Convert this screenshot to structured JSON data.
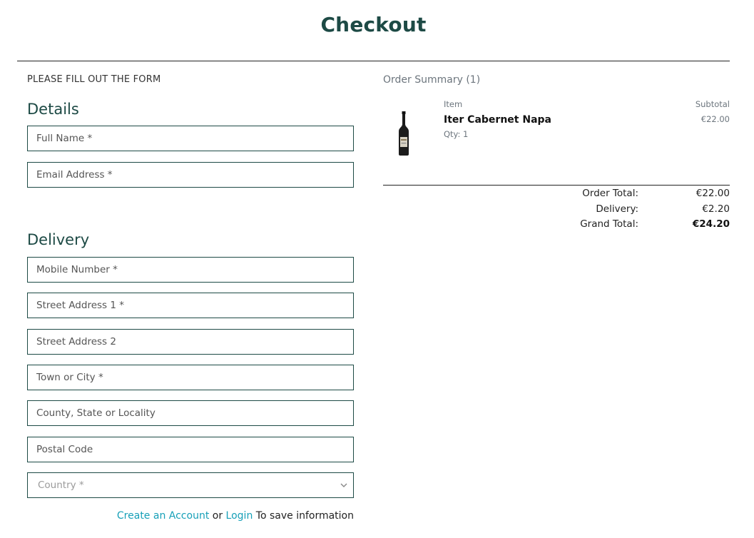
{
  "page": {
    "title": "Checkout"
  },
  "form": {
    "note": "PLEASE FILL OUT THE FORM",
    "details_heading": "Details",
    "delivery_heading": "Delivery",
    "fields": {
      "full_name": "Full Name *",
      "email": "Email Address *",
      "mobile": "Mobile Number *",
      "street1": "Street Address 1 *",
      "street2": "Street Address 2",
      "town": "Town or City *",
      "county": "County, State or Locality",
      "postal": "Postal Code",
      "country": "Country *"
    },
    "account_prompt": {
      "create_link": "Create an Account",
      "or_text": "or",
      "login_link": "Login",
      "suffix": "To save information"
    }
  },
  "summary": {
    "title": "Order Summary (1)",
    "col_item": "Item",
    "col_subtotal": "Subtotal",
    "items": [
      {
        "name": "Iter Cabernet Napa",
        "qty": "Qty: 1",
        "subtotal": "€22.00",
        "image": "wine-bottle"
      }
    ],
    "totals": {
      "order_total_label": "Order Total:",
      "order_total_value": "€22.00",
      "delivery_label": "Delivery:",
      "delivery_value": "€2.20",
      "grand_total_label": "Grand Total:",
      "grand_total_value": "€24.20"
    }
  },
  "colors": {
    "brand": "#1d4a45",
    "link": "#17a0b8"
  }
}
